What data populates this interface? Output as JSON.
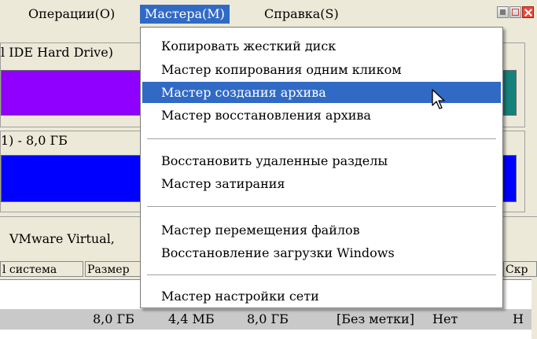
{
  "menubar": {
    "items": [
      "Операции(O)",
      "Мастера(M)",
      "Справка(S)"
    ]
  },
  "disk1": {
    "title": "l IDE Hard Drive)"
  },
  "disk2": {
    "title": "1) - 8,0 ГБ"
  },
  "bottom": {
    "vm_label": "VMware Virtual,",
    "columns": [
      "l система",
      "Размер",
      "Скр"
    ],
    "row": {
      "size": "8,0 ГБ",
      "used": "4,4 МБ",
      "total": "8,0 ГБ",
      "label": "[Без метки]",
      "flag": "Нет",
      "last": "Н"
    }
  },
  "dropdown": {
    "items": [
      "Копировать жесткий диск",
      "Мастер копирования одним кликом",
      "Мастер создания архива",
      "Мастер восстановления архива",
      "Восстановить удаленные разделы",
      "Мастер затирания",
      "Мастер перемещения файлов",
      "Восстановление загрузки Windows",
      "Мастер настройки сети"
    ],
    "highlighted_index": 2
  },
  "colors": {
    "purple_bar": "#8f00ff",
    "blue_bar": "#0000ff",
    "teal_segment": "#16807a",
    "highlight": "#316ac5"
  }
}
